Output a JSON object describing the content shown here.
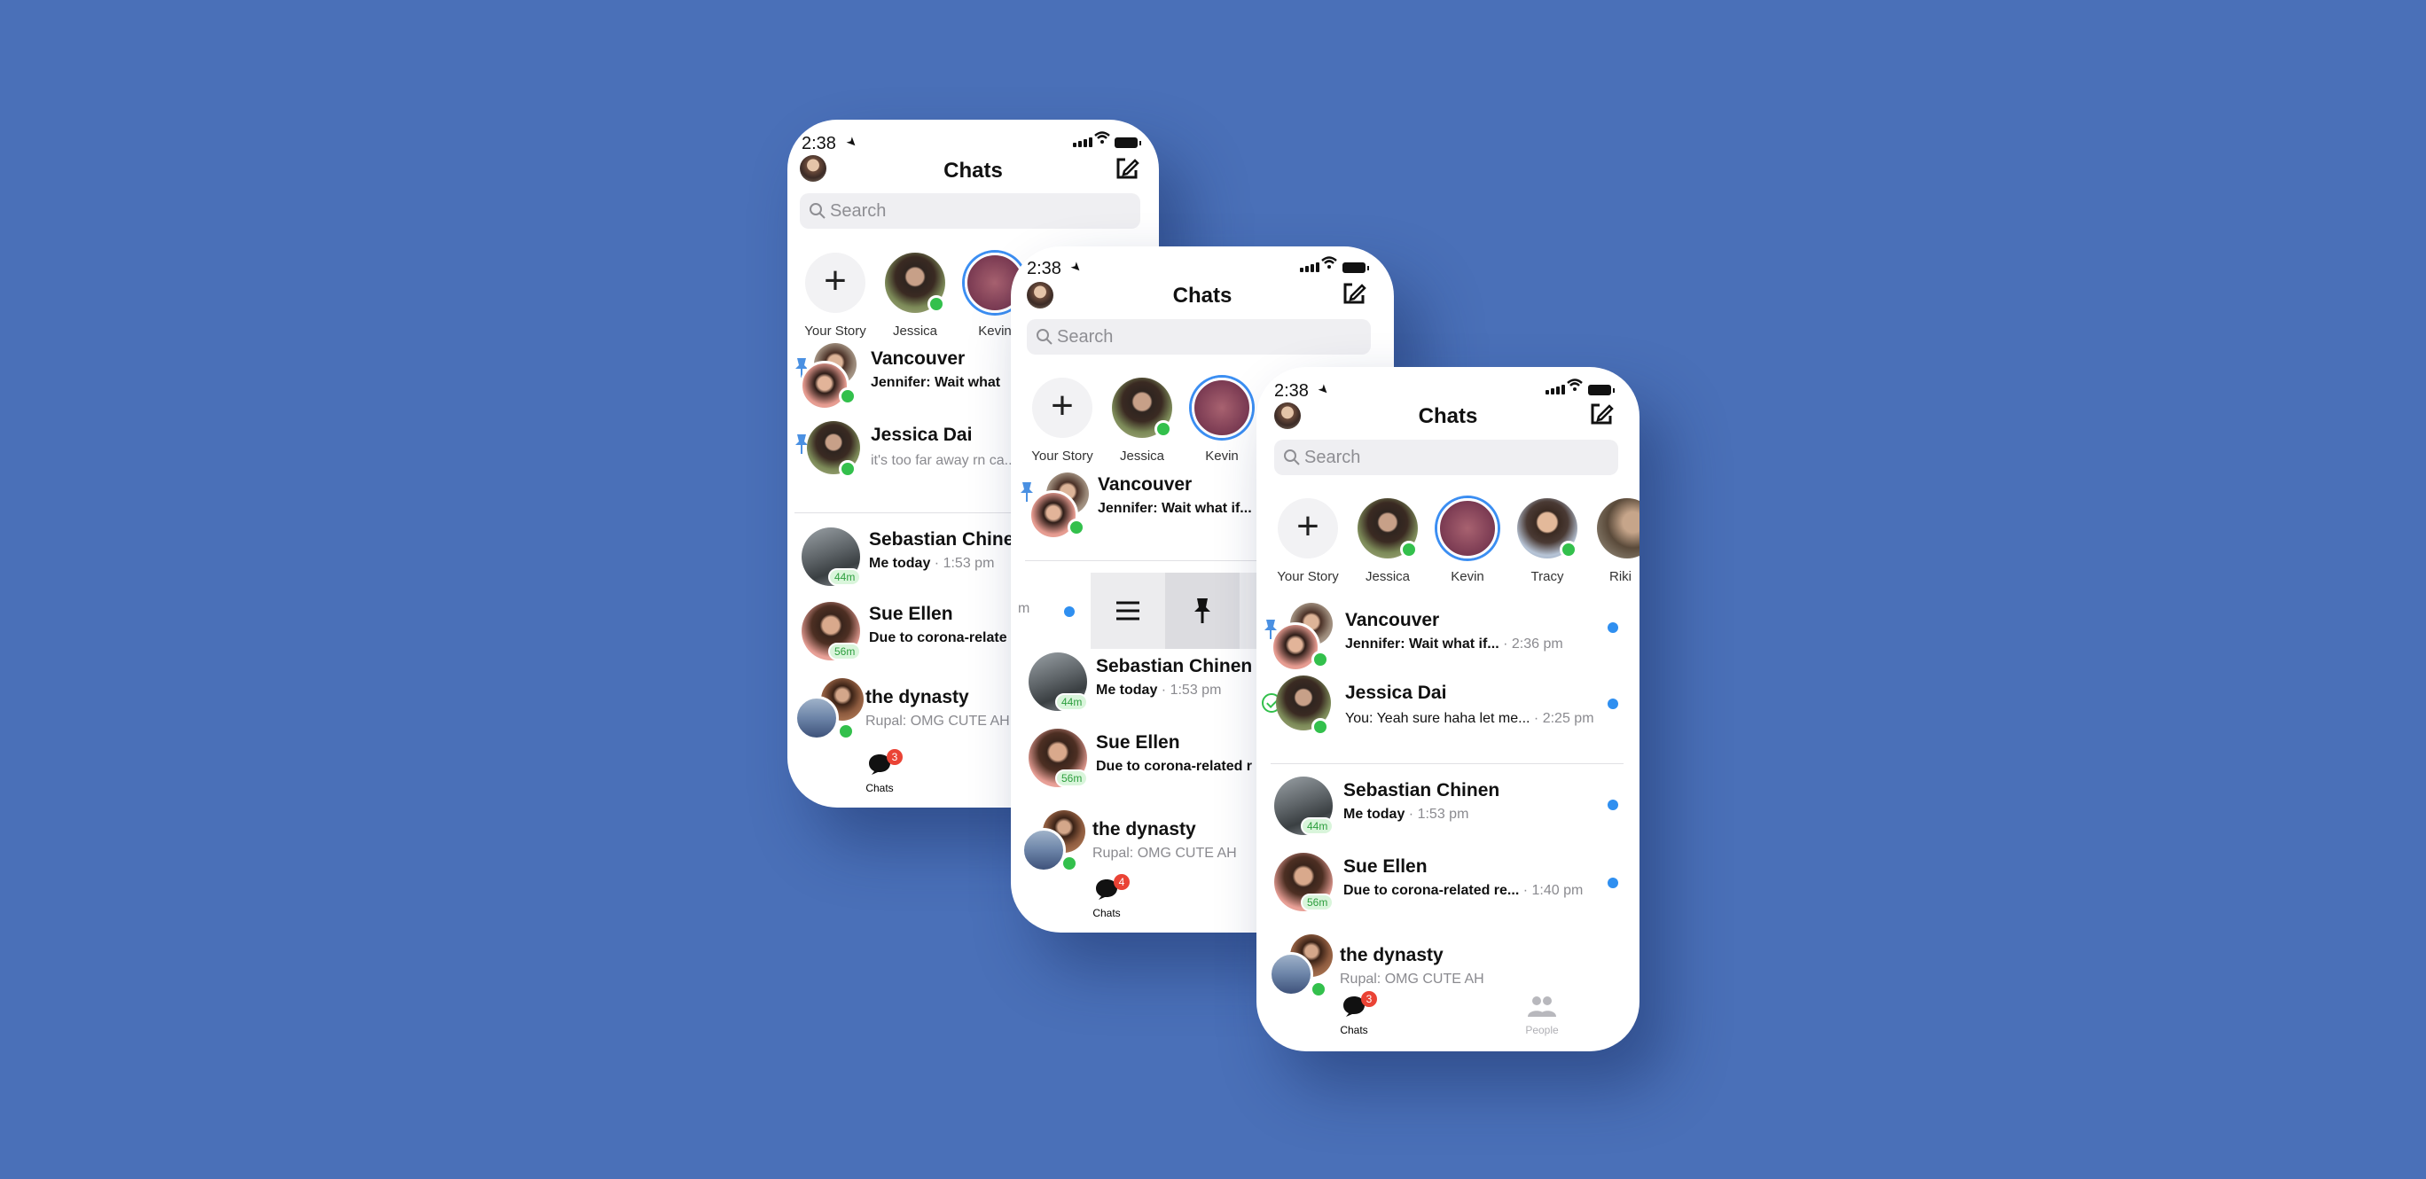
{
  "colors": {
    "background": "#4a70b8",
    "online": "#33c04c",
    "unread": "#2f8ff0",
    "badge": "#ea4335",
    "story_ring": "#3b8ef2"
  },
  "status": {
    "time": "2:38"
  },
  "header": {
    "title": "Chats"
  },
  "search": {
    "placeholder": "Search"
  },
  "stories": [
    {
      "label": "Your Story",
      "type": "add"
    },
    {
      "label": "Jessica",
      "online": true
    },
    {
      "label": "Kevin",
      "ring": true
    },
    {
      "label": "Tracy",
      "online": true
    },
    {
      "label": "Riki"
    }
  ],
  "chats": [
    {
      "name": "Vancouver",
      "preview": "Jennifer: Wait what if...",
      "time": "2:36 pm",
      "pinned": true,
      "unread": true,
      "group": true
    },
    {
      "name": "Jessica Dai",
      "preview": "You: Yeah sure haha let me...",
      "time": "2:25 pm",
      "unread": true
    },
    {
      "name": "Sebastian Chinen",
      "preview_bold": "Me today",
      "time": "1:53 pm",
      "unread": true,
      "active_ago": "44m"
    },
    {
      "name": "Sue Ellen",
      "preview": "Due to corona-related re...",
      "time": "1:40 pm",
      "unread": true,
      "active_ago": "56m"
    },
    {
      "name": "the dynasty",
      "preview": "Rupal: OMG CUTE AH",
      "group": true
    }
  ],
  "phone1": {
    "vancouver_preview": "Jennifer: Wait what",
    "jessica_preview": "it's too far away rn ca...",
    "sue_preview": "Due to corona-relate",
    "badge": "3"
  },
  "phone2": {
    "vancouver_preview": "Jennifer: Wait what if...",
    "sue_preview": "Due to corona-related r",
    "swipe_left_text": "m",
    "badge": "4"
  },
  "tabs": {
    "chats": "Chats",
    "people": "People",
    "badge": "3"
  },
  "icons": [
    "location-arrow-icon",
    "signal-icon",
    "wifi-icon",
    "battery-icon",
    "compose-icon",
    "search-icon",
    "plus-icon",
    "pin-icon",
    "check-icon",
    "menu-icon",
    "chat-bubble-icon",
    "people-icon"
  ]
}
